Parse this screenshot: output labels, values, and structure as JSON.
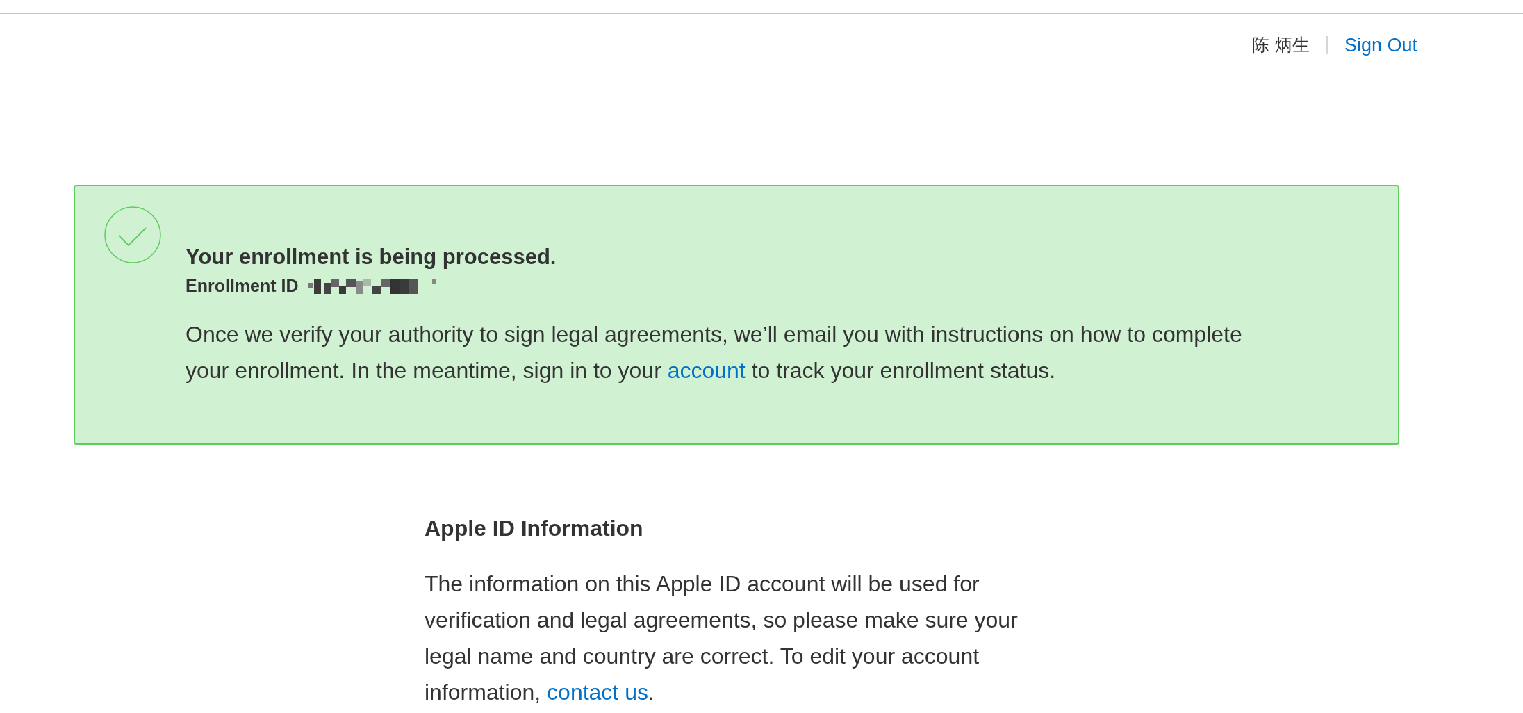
{
  "header": {
    "user_name": "陈 炳生",
    "sign_out": "Sign Out"
  },
  "banner": {
    "kind": "success",
    "title": "Your enrollment is being processed.",
    "id_label": "Enrollment ID",
    "message": [
      "Once we verify your authority to sign legal agreements, we’ll email you with instructions on how to complete your enrollment. In the meantime, sign in to your ",
      {
        "link": "account"
      },
      " to track your enrollment status."
    ]
  },
  "section": {
    "heading": "Apple ID Information",
    "text": [
      "The information on this Apple ID account will be used for verification and legal agreements, so please make sure your legal name and country are correct. To edit your account information, ",
      {
        "link": "contact us"
      },
      "."
    ]
  }
}
